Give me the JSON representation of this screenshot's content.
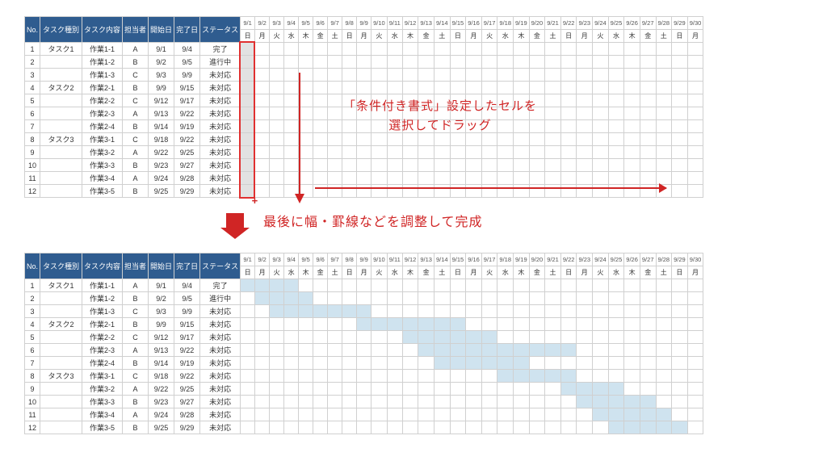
{
  "headers": {
    "no": "No.",
    "category": "タスク種別",
    "task": "タスク内容",
    "person": "担当者",
    "start": "開始日",
    "end": "完了日",
    "status": "ステータス"
  },
  "dates": [
    "9/1",
    "9/2",
    "9/3",
    "9/4",
    "9/5",
    "9/6",
    "9/7",
    "9/8",
    "9/9",
    "9/10",
    "9/11",
    "9/12",
    "9/13",
    "9/14",
    "9/15",
    "9/16",
    "9/17",
    "9/18",
    "9/19",
    "9/20",
    "9/21",
    "9/22",
    "9/23",
    "9/24",
    "9/25",
    "9/26",
    "9/27",
    "9/28",
    "9/29",
    "9/30"
  ],
  "dows": [
    "日",
    "月",
    "火",
    "水",
    "木",
    "金",
    "土",
    "日",
    "月",
    "火",
    "水",
    "木",
    "金",
    "土",
    "日",
    "月",
    "火",
    "水",
    "木",
    "金",
    "土",
    "日",
    "月",
    "火",
    "水",
    "木",
    "金",
    "土",
    "日",
    "月"
  ],
  "rows": [
    {
      "no": "1",
      "cat": "タスク1",
      "task": "作業1-1",
      "p": "A",
      "s": "9/1",
      "e": "9/4",
      "st": "完了",
      "start": 1,
      "end": 4,
      "sep": false
    },
    {
      "no": "2",
      "cat": "",
      "task": "作業1-2",
      "p": "B",
      "s": "9/2",
      "e": "9/5",
      "st": "進行中",
      "start": 2,
      "end": 5,
      "sep": false
    },
    {
      "no": "3",
      "cat": "",
      "task": "作業1-3",
      "p": "C",
      "s": "9/3",
      "e": "9/9",
      "st": "未対応",
      "start": 3,
      "end": 9,
      "sep": false
    },
    {
      "no": "4",
      "cat": "タスク2",
      "task": "作業2-1",
      "p": "B",
      "s": "9/9",
      "e": "9/15",
      "st": "未対応",
      "start": 9,
      "end": 15,
      "sep": true
    },
    {
      "no": "5",
      "cat": "",
      "task": "作業2-2",
      "p": "C",
      "s": "9/12",
      "e": "9/17",
      "st": "未対応",
      "start": 12,
      "end": 17,
      "sep": false
    },
    {
      "no": "6",
      "cat": "",
      "task": "作業2-3",
      "p": "A",
      "s": "9/13",
      "e": "9/22",
      "st": "未対応",
      "start": 13,
      "end": 22,
      "sep": false
    },
    {
      "no": "7",
      "cat": "",
      "task": "作業2-4",
      "p": "B",
      "s": "9/14",
      "e": "9/19",
      "st": "未対応",
      "start": 14,
      "end": 19,
      "sep": false
    },
    {
      "no": "8",
      "cat": "タスク3",
      "task": "作業3-1",
      "p": "C",
      "s": "9/18",
      "e": "9/22",
      "st": "未対応",
      "start": 18,
      "end": 22,
      "sep": true
    },
    {
      "no": "9",
      "cat": "",
      "task": "作業3-2",
      "p": "A",
      "s": "9/22",
      "e": "9/25",
      "st": "未対応",
      "start": 22,
      "end": 25,
      "sep": false
    },
    {
      "no": "10",
      "cat": "",
      "task": "作業3-3",
      "p": "B",
      "s": "9/23",
      "e": "9/27",
      "st": "未対応",
      "start": 23,
      "end": 27,
      "sep": false
    },
    {
      "no": "11",
      "cat": "",
      "task": "作業3-4",
      "p": "A",
      "s": "9/24",
      "e": "9/28",
      "st": "未対応",
      "start": 24,
      "end": 28,
      "sep": false
    },
    {
      "no": "12",
      "cat": "",
      "task": "作業3-5",
      "p": "B",
      "s": "9/25",
      "e": "9/29",
      "st": "未対応",
      "start": 25,
      "end": 29,
      "sep": false
    }
  ],
  "annot": {
    "line1": "「条件付き書式」設定したセルを",
    "line2": "選択してドラッグ",
    "final": "最後に幅・罫線などを調整して完成"
  }
}
